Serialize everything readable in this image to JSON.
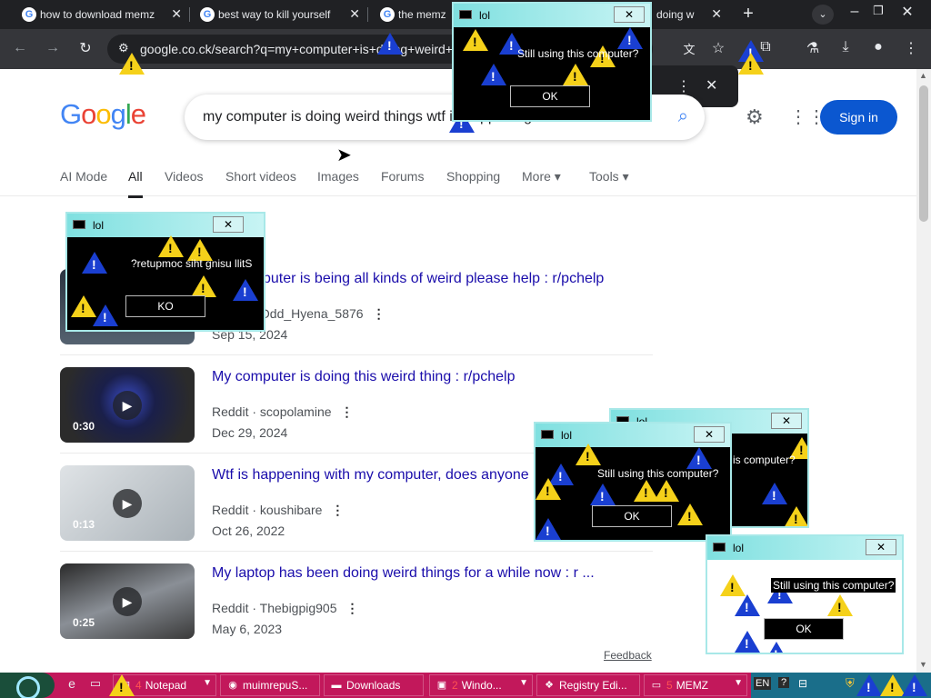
{
  "browser": {
    "tabs": [
      {
        "title": "how to download memz"
      },
      {
        "title": "best way to kill yourself"
      },
      {
        "title": "the memz"
      },
      {
        "title": "doing w"
      }
    ],
    "url": "google.co.ck/search?q=my+computer+is+doing+weird+things+wtf+is+happening"
  },
  "page": {
    "logo": "Google",
    "query": "my computer is doing weird things wtf is happening",
    "signin": "Sign in",
    "nav_tabs": [
      "AI Mode",
      "All",
      "Videos",
      "Short videos",
      "Images",
      "Forums",
      "Shopping",
      "More",
      "Tools"
    ],
    "active_tab": "All",
    "results": [
      {
        "title": "My computer is being all kinds of weird please help : r/pchelp",
        "source": "Reddit · Odd_Hyena_5876",
        "date": "Sep 15, 2024",
        "duration": ""
      },
      {
        "title": "My computer is doing this weird thing : r/pchelp",
        "source": "Reddit · scopolamine",
        "date": "Dec 29, 2024",
        "duration": "0:30"
      },
      {
        "title": "Wtf is happening with my computer, does anyone",
        "source": "Reddit · koushibare",
        "date": "Oct 26, 2022",
        "duration": "0:13"
      },
      {
        "title": "My laptop has been doing weird things for a while now : r ...",
        "source": "Reddit · Thebigpig905",
        "date": "May 6, 2023",
        "duration": "0:25"
      }
    ],
    "feedback": "Feedback"
  },
  "popups": [
    {
      "title": "lol",
      "message": "Still using this computer?",
      "button": "OK"
    },
    {
      "title": "lol",
      "message": "?retupmoc siht gnisu llitS",
      "button": "KO"
    },
    {
      "title": "lol",
      "message": "is computer?",
      "button": ""
    },
    {
      "title": "lol",
      "message": "Still using this computer?",
      "button": "OK"
    },
    {
      "title": "lol",
      "message": "Still using this computer?",
      "button": "OK"
    }
  ],
  "taskbar": {
    "items": [
      {
        "label": "Notepad",
        "num": "4"
      },
      {
        "label": "muimrepuS..."
      },
      {
        "label": "Downloads"
      },
      {
        "label": "Windo...",
        "num": "2"
      },
      {
        "label": "Registry Edi..."
      },
      {
        "label": "MEMZ",
        "num": "5"
      }
    ],
    "lang": "EN"
  },
  "colors": {
    "google_blue": "#4285f4",
    "link": "#1a0dab",
    "taskbar": "#c2185b",
    "popup_title": "#7fe0e0",
    "signin": "#0b57d0"
  }
}
